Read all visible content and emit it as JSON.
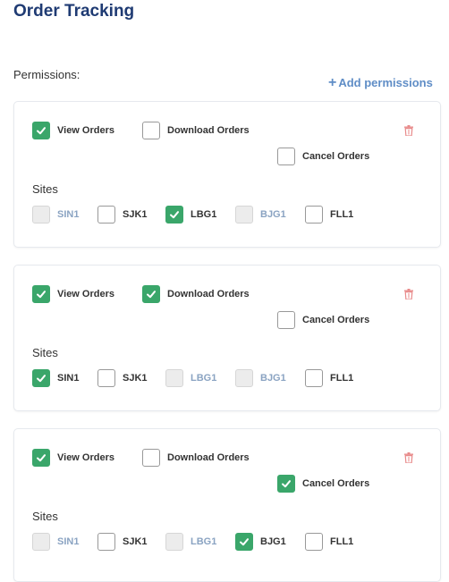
{
  "title": "Order Tracking",
  "permissions_label": "Permissions:",
  "add_permissions": "Add permissions",
  "sites_label": "Sites",
  "colors": {
    "accent": "#3aa66a",
    "title": "#1f3b73",
    "link": "#5f8dc6",
    "trash": "#e88a8a"
  },
  "cards": [
    {
      "view": {
        "label": "View Orders",
        "checked": true
      },
      "download": {
        "label": "Download Orders",
        "checked": false
      },
      "cancel": {
        "label": "Cancel Orders",
        "checked": false
      },
      "sites": [
        {
          "label": "SIN1",
          "checked": false,
          "disabled": true
        },
        {
          "label": "SJK1",
          "checked": false,
          "disabled": false
        },
        {
          "label": "LBG1",
          "checked": true,
          "disabled": false
        },
        {
          "label": "BJG1",
          "checked": false,
          "disabled": true
        },
        {
          "label": "FLL1",
          "checked": false,
          "disabled": false
        }
      ]
    },
    {
      "view": {
        "label": "View Orders",
        "checked": true
      },
      "download": {
        "label": "Download Orders",
        "checked": true
      },
      "cancel": {
        "label": "Cancel Orders",
        "checked": false
      },
      "sites": [
        {
          "label": "SIN1",
          "checked": true,
          "disabled": false
        },
        {
          "label": "SJK1",
          "checked": false,
          "disabled": false
        },
        {
          "label": "LBG1",
          "checked": false,
          "disabled": true
        },
        {
          "label": "BJG1",
          "checked": false,
          "disabled": true
        },
        {
          "label": "FLL1",
          "checked": false,
          "disabled": false
        }
      ]
    },
    {
      "view": {
        "label": "View Orders",
        "checked": true
      },
      "download": {
        "label": "Download Orders",
        "checked": false
      },
      "cancel": {
        "label": "Cancel Orders",
        "checked": true
      },
      "sites": [
        {
          "label": "SIN1",
          "checked": false,
          "disabled": true
        },
        {
          "label": "SJK1",
          "checked": false,
          "disabled": false
        },
        {
          "label": "LBG1",
          "checked": false,
          "disabled": true
        },
        {
          "label": "BJG1",
          "checked": true,
          "disabled": false
        },
        {
          "label": "FLL1",
          "checked": false,
          "disabled": false
        }
      ]
    }
  ]
}
